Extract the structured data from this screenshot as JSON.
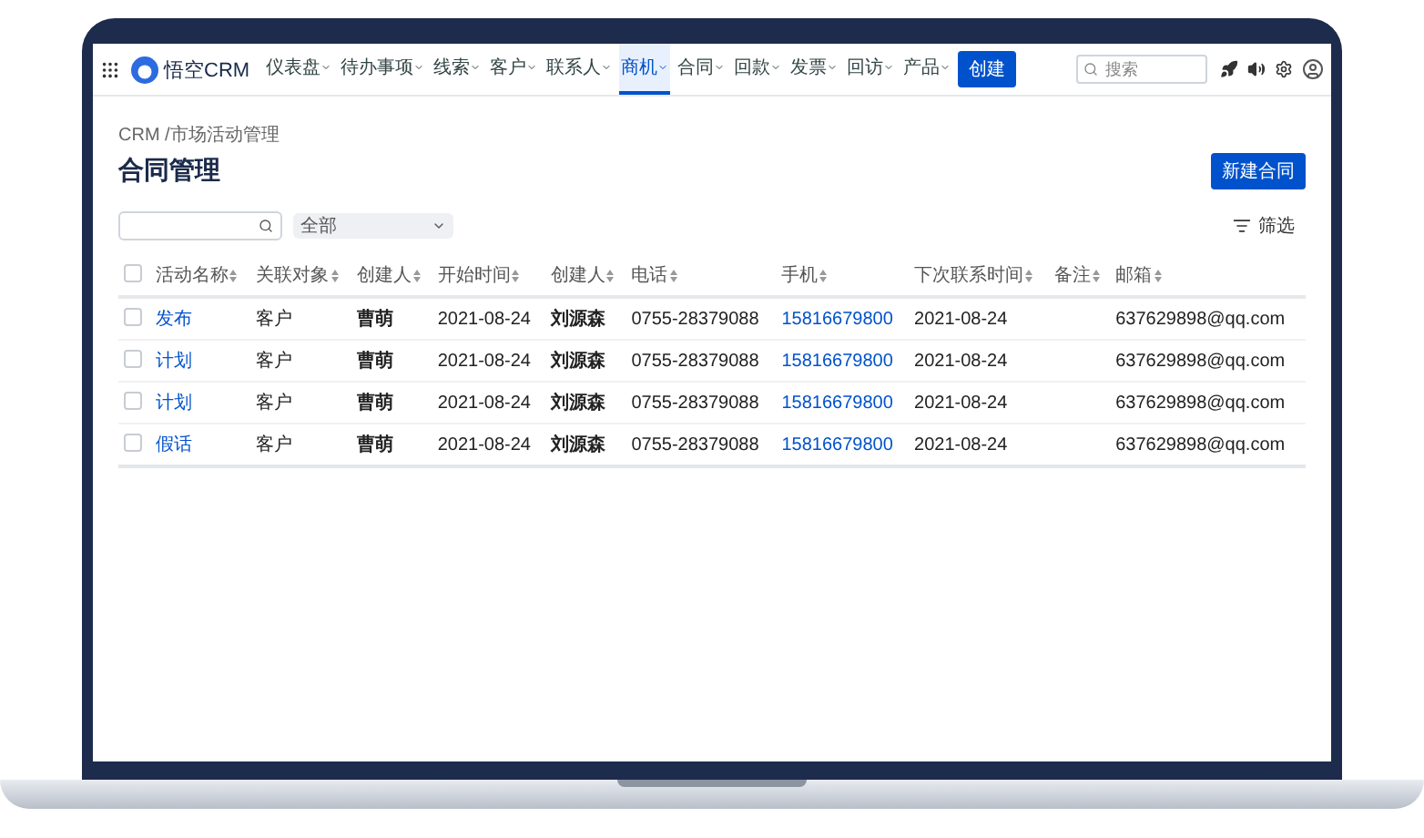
{
  "app": {
    "name": "悟空CRM"
  },
  "nav": [
    {
      "label": "仪表盘",
      "selected": false
    },
    {
      "label": "待办事项",
      "selected": false
    },
    {
      "label": "线索",
      "selected": false
    },
    {
      "label": "客户",
      "selected": false
    },
    {
      "label": "联系人",
      "selected": false
    },
    {
      "label": "商机",
      "selected": true
    },
    {
      "label": "合同",
      "selected": false
    },
    {
      "label": "回款",
      "selected": false
    },
    {
      "label": "发票",
      "selected": false
    },
    {
      "label": "回访",
      "selected": false
    },
    {
      "label": "产品",
      "selected": false
    }
  ],
  "create_button": "创建",
  "search": {
    "placeholder": "搜索"
  },
  "breadcrumb": "CRM /市场活动管理",
  "page_title": "合同管理",
  "new_button": "新建合同",
  "filter_select": {
    "value": "全部"
  },
  "filter_button": "筛选",
  "table": {
    "all_checked": false,
    "columns": [
      "活动名称",
      "关联对象",
      "创建人",
      "开始时间",
      "创建人",
      "电话",
      "手机",
      "下次联系时间",
      "备注",
      "邮箱"
    ],
    "rows": [
      {
        "checked": false,
        "cells": [
          "发布",
          "客户",
          "曹萌",
          "2021-08-24",
          "刘源森",
          "0755-28379088",
          "15816679800",
          "2021-08-24",
          "",
          "637629898@qq.com"
        ]
      },
      {
        "checked": false,
        "cells": [
          "计划",
          "客户",
          "曹萌",
          "2021-08-24",
          "刘源森",
          "0755-28379088",
          "15816679800",
          "2021-08-24",
          "",
          "637629898@qq.com"
        ]
      },
      {
        "checked": false,
        "cells": [
          "计划",
          "客户",
          "曹萌",
          "2021-08-24",
          "刘源森",
          "0755-28379088",
          "15816679800",
          "2021-08-24",
          "",
          "637629898@qq.com"
        ]
      },
      {
        "checked": false,
        "cells": [
          "假话",
          "客户",
          "曹萌",
          "2021-08-24",
          "刘源森",
          "0755-28379088",
          "15816679800",
          "2021-08-24",
          "",
          "637629898@qq.com"
        ]
      }
    ]
  }
}
